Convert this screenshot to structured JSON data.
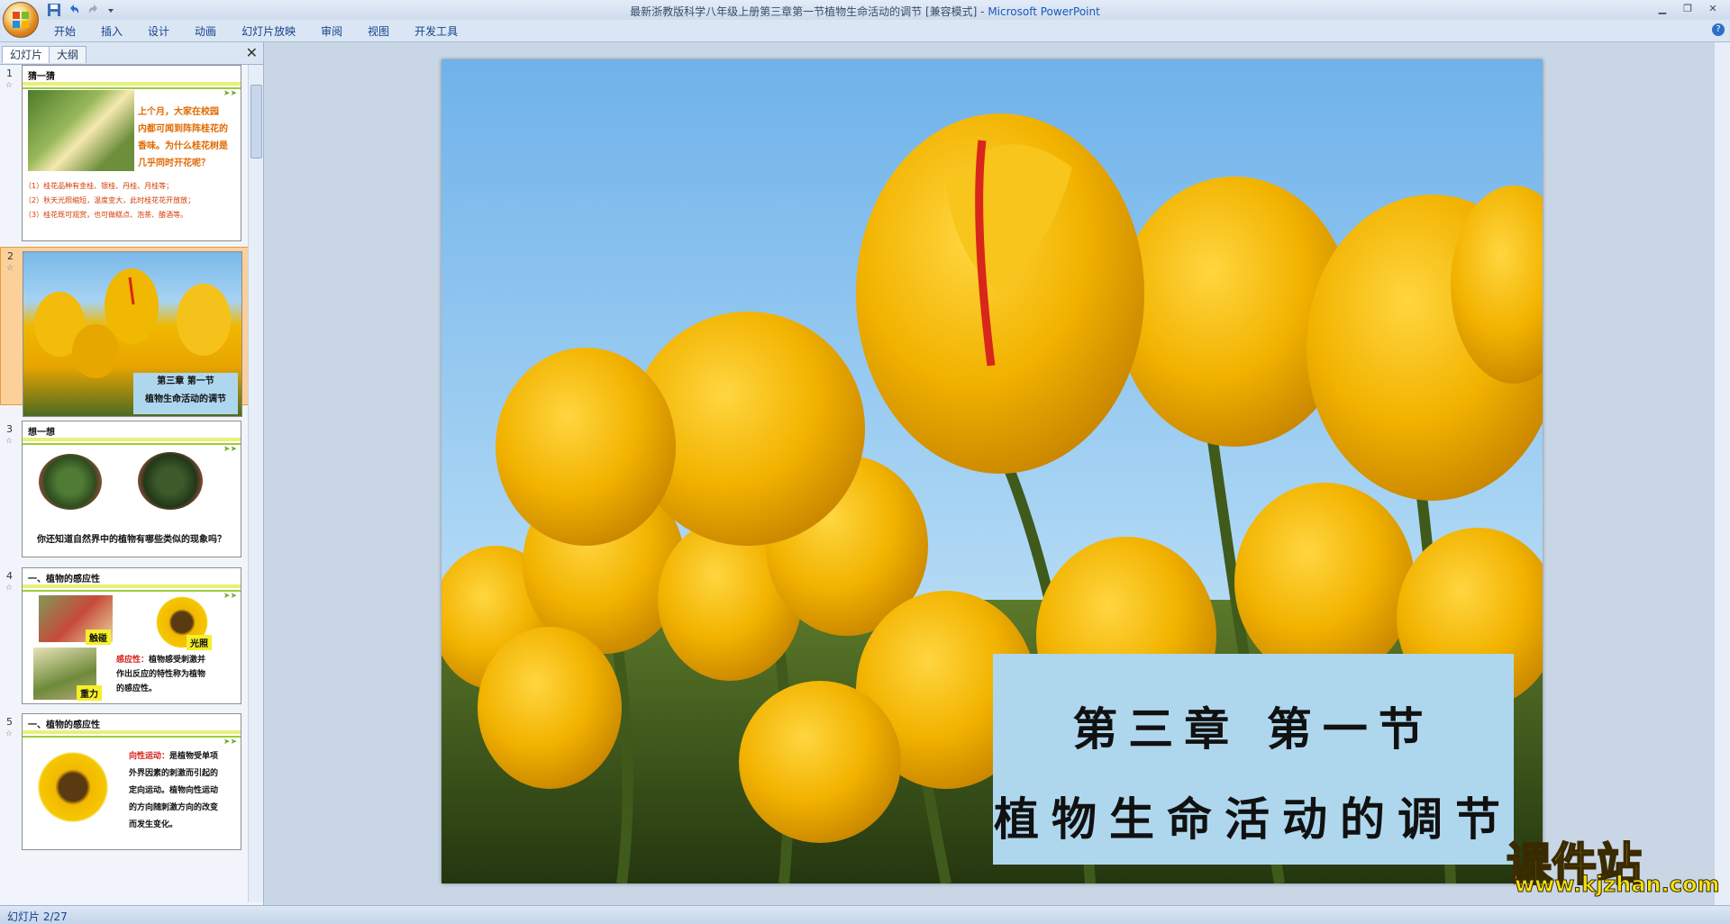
{
  "window": {
    "title": "最新浙教版科学八年级上册第三章第一节植物生命活动的调节 [兼容模式]",
    "separator": " - ",
    "app_name": "Microsoft PowerPoint"
  },
  "ribbon": {
    "tabs": [
      "开始",
      "插入",
      "设计",
      "动画",
      "幻灯片放映",
      "审阅",
      "视图",
      "开发工具"
    ]
  },
  "left_panel": {
    "tabs": [
      "幻灯片",
      "大纲"
    ],
    "active_tab": "幻灯片",
    "slides": [
      {
        "number": "1",
        "title": "猜一猜",
        "body": [
          "上个月，大家在校园",
          "内都可闻到阵阵桂花的",
          "香味。为什么桂花树是",
          "几乎同时开花呢？"
        ],
        "notes": [
          "（1）桂花品种有金桂、银桂、丹桂、月桂等；",
          "（2）秋天光照缩短，温度变大，此时桂花花开放放；",
          "（3）桂花既可观赏，也可做糕点、泡茶、酿酒等。"
        ]
      },
      {
        "number": "2",
        "caption": [
          "第三章 第一节",
          "植物生命活动的调节"
        ]
      },
      {
        "number": "3",
        "title": "想一想",
        "body": [
          "你还知道自然界中的植物有哪些类似的现象吗？"
        ]
      },
      {
        "number": "4",
        "title": "一、植物的感应性",
        "labels": [
          "触碰",
          "光照",
          "重力"
        ],
        "term": "感应性：",
        "body": [
          "植物感受刺激并",
          "作出反应的特性称为植物",
          "的感应性。"
        ]
      },
      {
        "number": "5",
        "title": "一、植物的感应性",
        "term": "向性运动：",
        "body": [
          "是植物受单项",
          "外界因素的刺激而引起的",
          "定向运动。植物向性运动",
          "的方向随刺激方向的改变",
          "而发生变化。"
        ]
      }
    ]
  },
  "main_slide": {
    "caption_line1": "第三章 第一节",
    "caption_line2": "植物生命活动的调节"
  },
  "watermark": {
    "text": "课件站",
    "url": "www.kjzhan.com"
  },
  "status_bar": {
    "slide_counter": "幻灯片 2/27"
  },
  "colors": {
    "ribbon_bg": "#dbe6f4",
    "selected_thumb": "#fbd09a",
    "caption_bg": "#aed7ee",
    "tulip_yellow": "#f0b400",
    "sky_blue": "#8fc6ee"
  }
}
